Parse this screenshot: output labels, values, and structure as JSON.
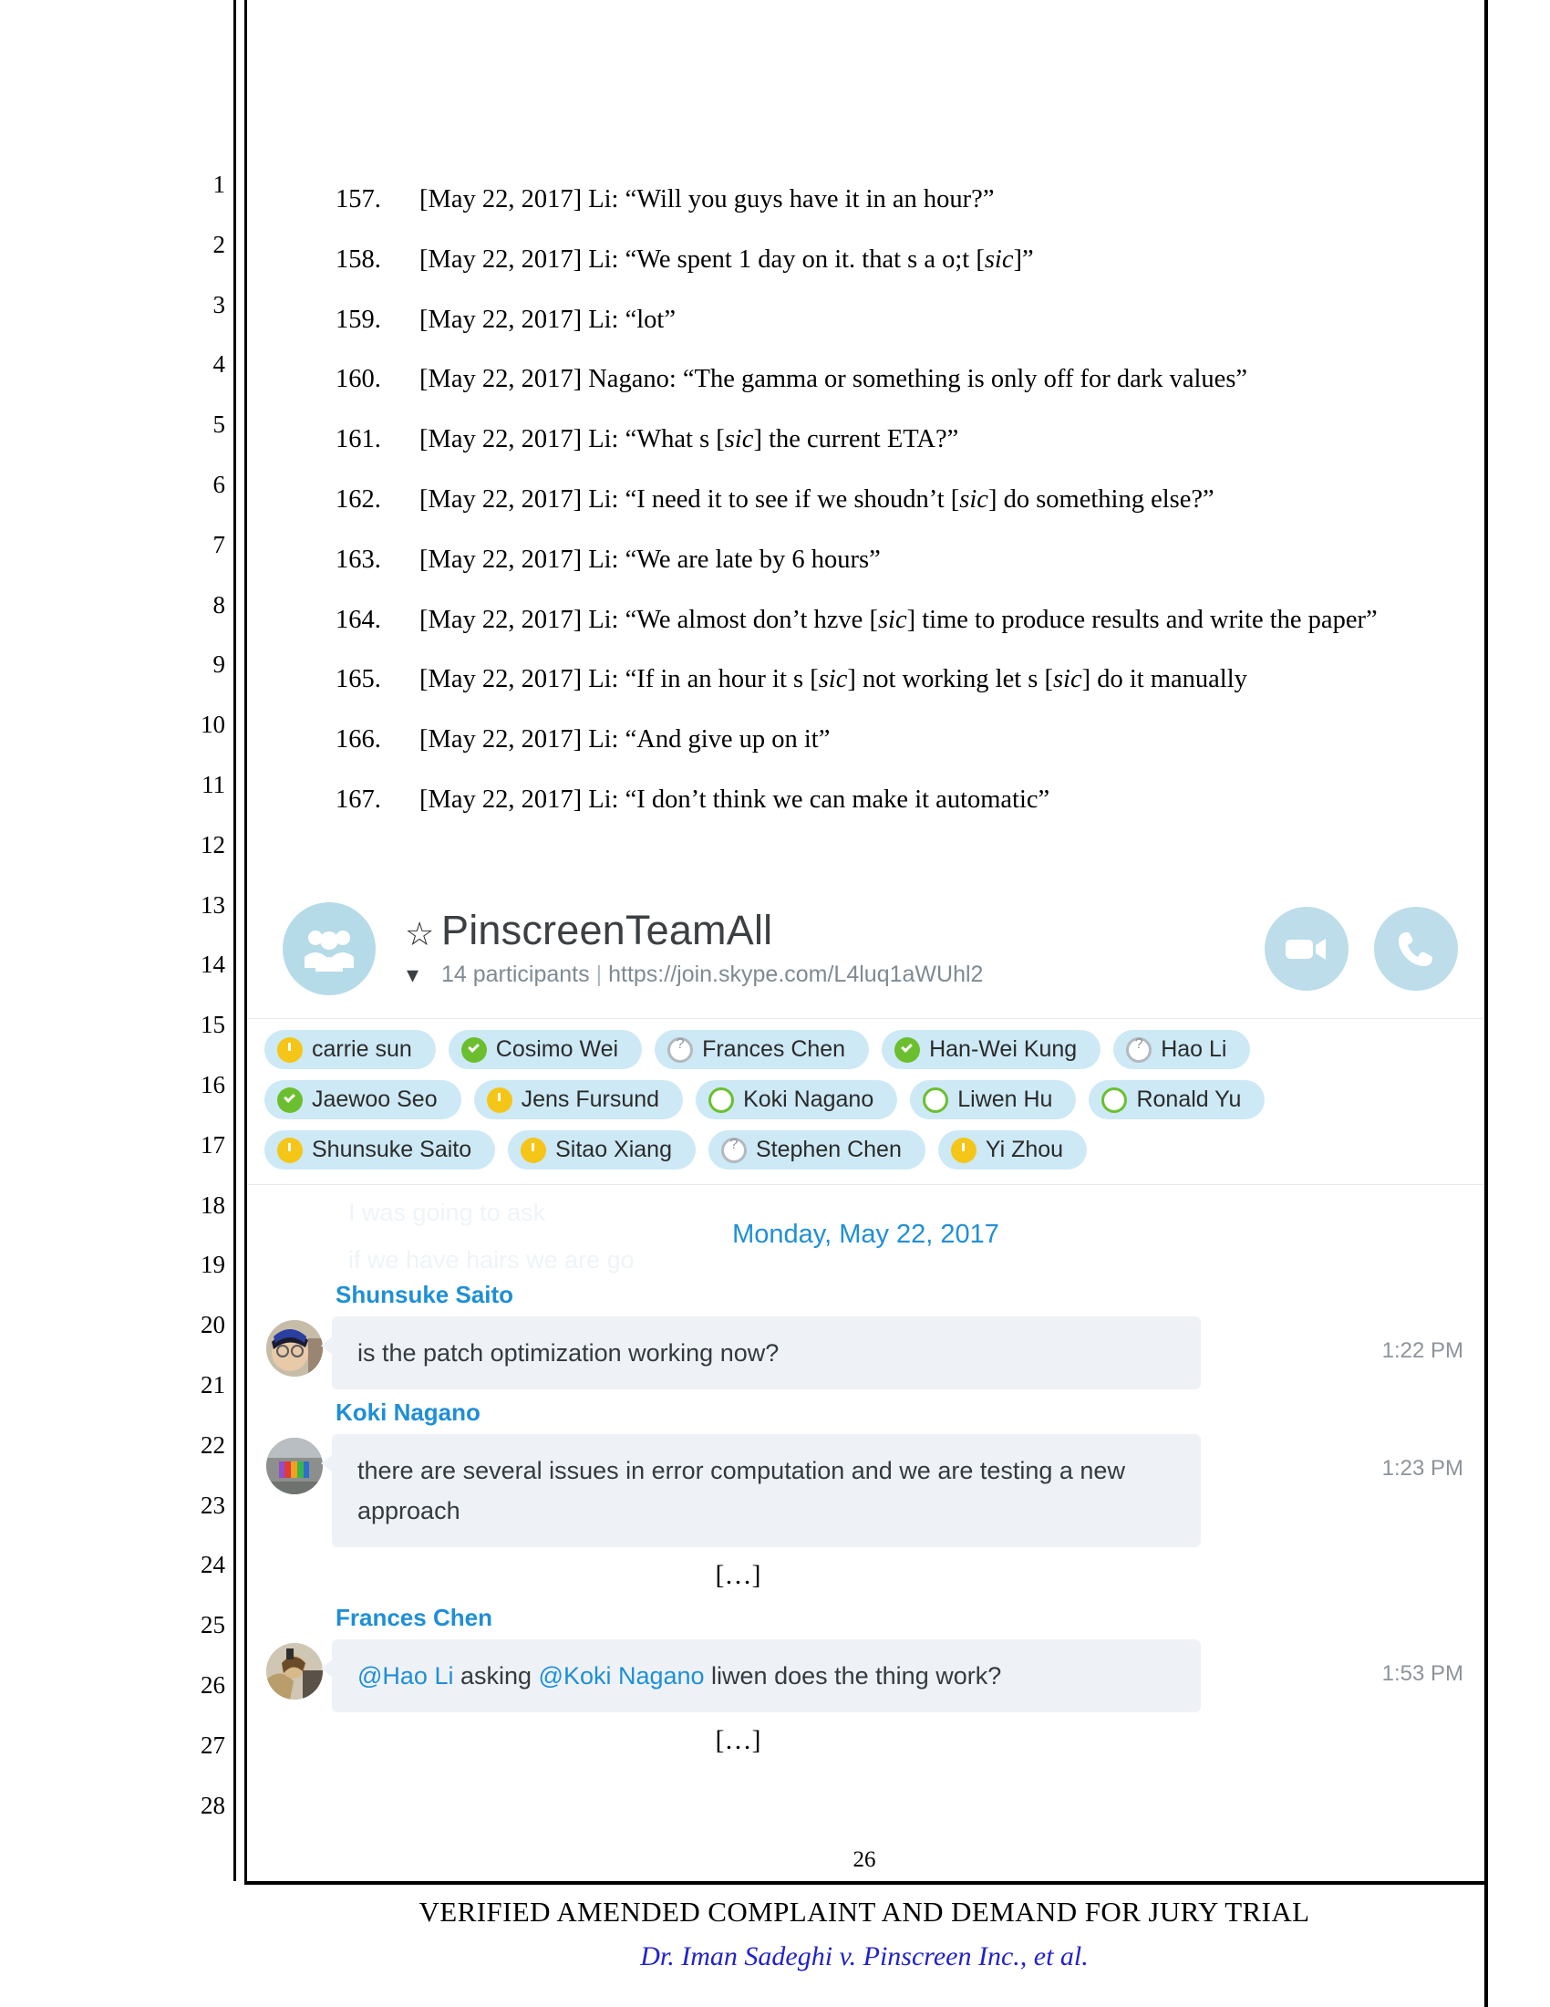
{
  "document": {
    "line_numbers": [
      "1",
      "2",
      "3",
      "4",
      "5",
      "6",
      "7",
      "8",
      "9",
      "10",
      "11",
      "12",
      "13",
      "14",
      "15",
      "16",
      "17",
      "18",
      "19",
      "20",
      "21",
      "22",
      "23",
      "24",
      "25",
      "26",
      "27",
      "28"
    ],
    "paragraphs": [
      {
        "num": "157.",
        "pre": "[May 22, 2017] Li: “Will you guys have it in an hour?”",
        "sic": "",
        "post": ""
      },
      {
        "num": "158.",
        "pre": "[May 22, 2017] Li: “We spent 1 day on it. that s a o;t [",
        "sic": "sic",
        "post": "]”"
      },
      {
        "num": "159.",
        "pre": "[May 22, 2017] Li: “lot”",
        "sic": "",
        "post": ""
      },
      {
        "num": "160.",
        "pre": "[May 22, 2017] Nagano: “The gamma or something is only off for dark values”",
        "sic": "",
        "post": ""
      },
      {
        "num": "161.",
        "pre": "[May 22, 2017] Li: “What s [",
        "sic": "sic",
        "post": "] the current ETA?”"
      },
      {
        "num": "162.",
        "pre": "[May 22, 2017] Li: “I need it to see if we shoudn’t [",
        "sic": "sic",
        "post": "] do something else?”"
      },
      {
        "num": "163.",
        "pre": "[May 22, 2017] Li: “We are late by 6 hours”",
        "sic": "",
        "post": ""
      },
      {
        "num": "164.",
        "pre": "[May 22, 2017] Li: “We almost don’t hzve [",
        "sic": "sic",
        "post": "] time to produce results and write the paper”"
      },
      {
        "num": "165.",
        "pre": "[May 22, 2017] Li: “If in an hour it s [",
        "sic": "sic",
        "post": "] not working let s [",
        "sic2": "sic",
        "post2": "] do it manually"
      },
      {
        "num": "166.",
        "pre": "[May 22, 2017] Li: “And give up on it”",
        "sic": "",
        "post": ""
      },
      {
        "num": "167.",
        "pre": "[May 22, 2017] Li: “I don’t think we can make it automatic”",
        "sic": "",
        "post": ""
      }
    ],
    "footer": {
      "page_number": "26",
      "title": "VERIFIED AMENDED COMPLAINT AND DEMAND FOR JURY TRIAL",
      "case_caption": "Dr. Iman Sadeghi v. Pinscreen Inc., et al."
    }
  },
  "skype": {
    "header": {
      "group_avatar_icon": "group-people-icon",
      "favorite_icon": "star-icon",
      "title": "PinscreenTeamAll",
      "expand_icon": "chevron-down-icon",
      "participants_count": "14 participants",
      "separator": "|",
      "join_link": "https://join.skype.com/L4luq1aWUhl2",
      "video_call_icon": "video-camera-icon",
      "audio_call_icon": "phone-icon"
    },
    "participants": [
      [
        {
          "name": "carrie sun",
          "status": "away"
        },
        {
          "name": "Cosimo Wei",
          "status": "online"
        },
        {
          "name": "Frances Chen",
          "status": "unknown"
        },
        {
          "name": "Han-Wei Kung",
          "status": "online"
        },
        {
          "name": "Hao Li",
          "status": "unknown"
        }
      ],
      [
        {
          "name": "Jaewoo Seo",
          "status": "online"
        },
        {
          "name": "Jens Fursund",
          "status": "away"
        },
        {
          "name": "Koki Nagano",
          "status": "offline"
        },
        {
          "name": "Liwen Hu",
          "status": "offline"
        },
        {
          "name": "Ronald Yu",
          "status": "offline"
        }
      ],
      [
        {
          "name": "Shunsuke Saito",
          "status": "away"
        },
        {
          "name": "Sitao Xiang",
          "status": "away"
        },
        {
          "name": "Stephen Chen",
          "status": "unknown"
        },
        {
          "name": "Yi Zhou",
          "status": "away"
        }
      ]
    ],
    "conversation": {
      "ghost_line_1": "I was going to ask",
      "ghost_line_2": "if we have hairs we are go",
      "date_divider": "Monday, May 22, 2017",
      "messages": [
        {
          "sender": "Shunsuke Saito",
          "text": "is the patch optimization working now?",
          "time": "1:22 PM",
          "mention1": "",
          "mid": "",
          "mention2": "",
          "tail": ""
        },
        {
          "sender": "Koki Nagano",
          "text": "there are several issues in error computation and we are testing a new approach",
          "time": "1:23 PM",
          "mention1": "",
          "mid": "",
          "mention2": "",
          "tail": ""
        },
        {
          "sender": "Frances Chen",
          "text": "",
          "time": "1:53 PM",
          "mention1": "@Hao Li",
          "mid": " asking ",
          "mention2": "@Koki Nagano",
          "tail": " liwen does the thing work?"
        }
      ],
      "ellipsis": "[…]"
    }
  }
}
